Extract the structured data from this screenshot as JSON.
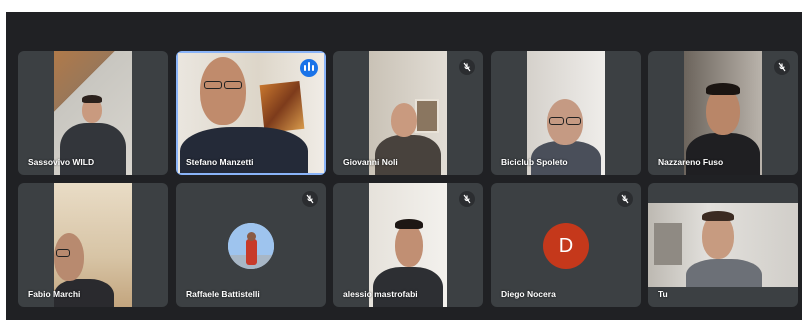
{
  "participants": [
    {
      "name": "Sassovivo WILD",
      "muted": false
    },
    {
      "name": "Stefano Manzetti",
      "muted": false,
      "speaking": true
    },
    {
      "name": "Giovanni Noli",
      "muted": true
    },
    {
      "name": "Biciclub Spoleto",
      "muted": false
    },
    {
      "name": "Nazzareno Fuso",
      "muted": true
    },
    {
      "name": "Fabio Marchi",
      "muted": false
    },
    {
      "name": "Raffaele Battistelli",
      "muted": true
    },
    {
      "name": "alessio mastrofabi",
      "muted": true
    },
    {
      "name": "Diego Nocera",
      "muted": true,
      "avatar_letter": "D"
    },
    {
      "name": "Tu",
      "muted": false
    }
  ],
  "colors": {
    "background": "#202124",
    "tile": "#3c4043",
    "active_border": "#8ab4f8",
    "speaking_badge": "#1a73e8",
    "avatar_letter_bg": "#c5381b"
  },
  "icons": {
    "muted": "mic-off-icon",
    "speaking": "audio-level-icon"
  }
}
